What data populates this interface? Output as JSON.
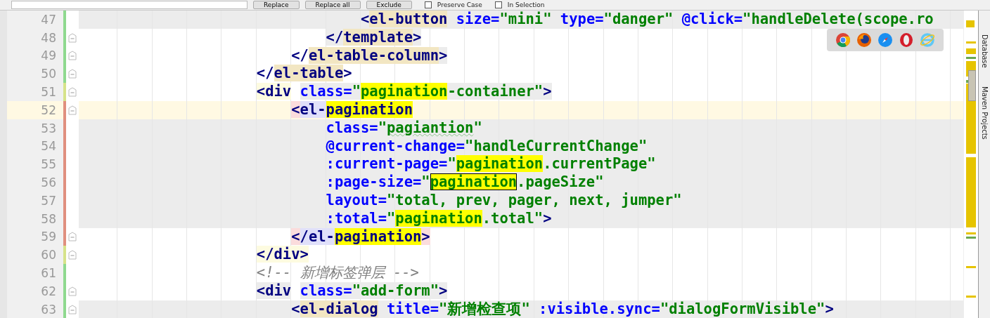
{
  "find_bar": {
    "buttons": [
      "Replace",
      "Replace all",
      "Exclude"
    ],
    "options": [
      {
        "label": "Preserve Case",
        "checked": false
      },
      {
        "label": "In Selection",
        "checked": false
      }
    ]
  },
  "editor": {
    "lines": [
      {
        "number": "47",
        "kind": "shaded",
        "color": "#8fd98f",
        "fold": false,
        "tokens": [
          {
            "t": "                                <",
            "kind": "tag"
          },
          {
            "t": "el-button",
            "kind": "tag",
            "paired": true
          },
          {
            "t": " size=",
            "kind": "attr"
          },
          {
            "t": "\"mini\"",
            "kind": "value"
          },
          {
            "t": " type=",
            "kind": "attr"
          },
          {
            "t": "\"danger\"",
            "kind": "value"
          },
          {
            "t": " @click=",
            "kind": "attr"
          },
          {
            "t": "\"handleDelete(scope.ro",
            "kind": "value"
          }
        ]
      },
      {
        "number": "48",
        "kind": "plain",
        "color": "#8fd98f",
        "fold": true,
        "tokens": [
          {
            "t": "                            </",
            "kind": "tag",
            "shaded": true
          },
          {
            "t": "template",
            "kind": "tag",
            "paired": true
          },
          {
            "t": ">",
            "kind": "tag",
            "shaded": true
          }
        ]
      },
      {
        "number": "49",
        "kind": "plain",
        "color": "#8fd98f",
        "fold": true,
        "tokens": [
          {
            "t": "                        </",
            "kind": "tag"
          },
          {
            "t": "el-table-column",
            "kind": "tag",
            "paired": true
          },
          {
            "t": ">",
            "kind": "tag",
            "shaded": true
          }
        ]
      },
      {
        "number": "50",
        "kind": "plain",
        "color": "#8fd98f",
        "fold": true,
        "tokens": [
          {
            "t": "                    </",
            "kind": "tag"
          },
          {
            "t": "el-table",
            "kind": "tag",
            "paired": true
          },
          {
            "t": ">",
            "kind": "tag"
          }
        ]
      },
      {
        "number": "51",
        "kind": "plain",
        "color": "#d6e38a",
        "fold": true,
        "tokens": [
          {
            "t": "                    <div",
            "kind": "tag",
            "light": true
          },
          {
            "t": " class=",
            "kind": "attr",
            "shaded": true
          },
          {
            "t": "\"",
            "kind": "value",
            "shaded": true
          },
          {
            "t": "pagination",
            "kind": "value",
            "found": true
          },
          {
            "t": "-container\"",
            "kind": "value",
            "shaded": true
          },
          {
            "t": ">",
            "kind": "tag",
            "shaded": true
          }
        ]
      },
      {
        "number": "52",
        "kind": "caret",
        "color": "#e0907f",
        "fold": true,
        "tokens": [
          {
            "t": "                        <",
            "kind": "tag",
            "brace": true
          },
          {
            "t": "el-",
            "kind": "tag",
            "brace_name": true
          },
          {
            "t": "pagination",
            "kind": "tag",
            "found": true
          }
        ]
      },
      {
        "number": "53",
        "kind": "shaded",
        "color": "#e0907f",
        "fold": false,
        "tokens": [
          {
            "t": "                            class=",
            "kind": "attr"
          },
          {
            "t": "\"",
            "kind": "value"
          },
          {
            "t": "pagiantion",
            "kind": "value",
            "misspelled": true
          },
          {
            "t": "\"",
            "kind": "value"
          }
        ]
      },
      {
        "number": "54",
        "kind": "shaded",
        "color": "#e0907f",
        "fold": false,
        "tokens": [
          {
            "t": "                            @current-change=",
            "kind": "attr"
          },
          {
            "t": "\"handleCurrentChange\"",
            "kind": "value"
          }
        ]
      },
      {
        "number": "55",
        "kind": "shaded",
        "color": "#e0907f",
        "fold": false,
        "tokens": [
          {
            "t": "                            :current-page=",
            "kind": "attr"
          },
          {
            "t": "\"",
            "kind": "value"
          },
          {
            "t": "pagination",
            "kind": "value",
            "found": true
          },
          {
            "t": ".currentPage\"",
            "kind": "value"
          }
        ]
      },
      {
        "number": "56",
        "kind": "shaded",
        "color": "#e0907f",
        "fold": false,
        "tokens": [
          {
            "t": "                            :page-size=",
            "kind": "attr"
          },
          {
            "t": "\"",
            "kind": "value"
          },
          {
            "t": "pagination",
            "kind": "value",
            "found": true,
            "current": true
          },
          {
            "t": ".pageSize\"",
            "kind": "value"
          }
        ]
      },
      {
        "number": "57",
        "kind": "shaded",
        "color": "#e0907f",
        "fold": false,
        "tokens": [
          {
            "t": "                            layout=",
            "kind": "attr"
          },
          {
            "t": "\"total, prev, pager, next, jumper\"",
            "kind": "value"
          }
        ]
      },
      {
        "number": "58",
        "kind": "shaded",
        "color": "#e0907f",
        "fold": false,
        "tokens": [
          {
            "t": "                            :total=",
            "kind": "attr"
          },
          {
            "t": "\"",
            "kind": "value"
          },
          {
            "t": "pagination",
            "kind": "value",
            "found": true
          },
          {
            "t": ".total\"",
            "kind": "value"
          },
          {
            "t": ">",
            "kind": "tag"
          }
        ]
      },
      {
        "number": "59",
        "kind": "plain",
        "color": "#e0907f",
        "fold": true,
        "tokens": [
          {
            "t": "                        <",
            "kind": "tag",
            "brace": true
          },
          {
            "t": "/el-",
            "kind": "tag",
            "brace_name": true
          },
          {
            "t": "pagination",
            "kind": "tag",
            "found": true
          },
          {
            "t": ">",
            "kind": "tag",
            "brace": true
          }
        ]
      },
      {
        "number": "60",
        "kind": "plain",
        "color": "#d6e38a",
        "fold": true,
        "tokens": [
          {
            "t": "                    </div>",
            "kind": "tag",
            "light": true
          }
        ]
      },
      {
        "number": "61",
        "kind": "plain",
        "color": "#8fd98f",
        "fold": false,
        "tokens": [
          {
            "t": "                    <!-- 新增标签弹层 -->",
            "kind": "comment"
          }
        ]
      },
      {
        "number": "62",
        "kind": "plain",
        "color": "#8fd98f",
        "fold": true,
        "tokens": [
          {
            "t": "                    <div",
            "kind": "tag",
            "shaded": true
          },
          {
            "t": " class=",
            "kind": "attr",
            "shaded": true
          },
          {
            "t": "\"add-form\"",
            "kind": "value",
            "shaded": true
          },
          {
            "t": ">",
            "kind": "tag",
            "shaded": true
          }
        ]
      },
      {
        "number": "63",
        "kind": "shaded",
        "color": "#8fd98f",
        "fold": true,
        "tokens": [
          {
            "t": "                        <",
            "kind": "tag"
          },
          {
            "t": "el-dialog",
            "kind": "tag",
            "paired": true
          },
          {
            "t": " title=",
            "kind": "attr"
          },
          {
            "t": "\"新增检查项\"",
            "kind": "value"
          },
          {
            "t": " :visible.sync=",
            "kind": "attr"
          },
          {
            "t": "\"dialogFormVisible\"",
            "kind": "value"
          },
          {
            "t": ">",
            "kind": "tag"
          }
        ]
      }
    ]
  },
  "browser_popup": {
    "icons": [
      {
        "kind": "chrome"
      },
      {
        "kind": "firefox"
      },
      {
        "kind": "safari"
      },
      {
        "kind": "opera"
      },
      {
        "kind": "ie"
      }
    ]
  },
  "tool_windows": [
    "Database",
    "Maven Projects"
  ]
}
